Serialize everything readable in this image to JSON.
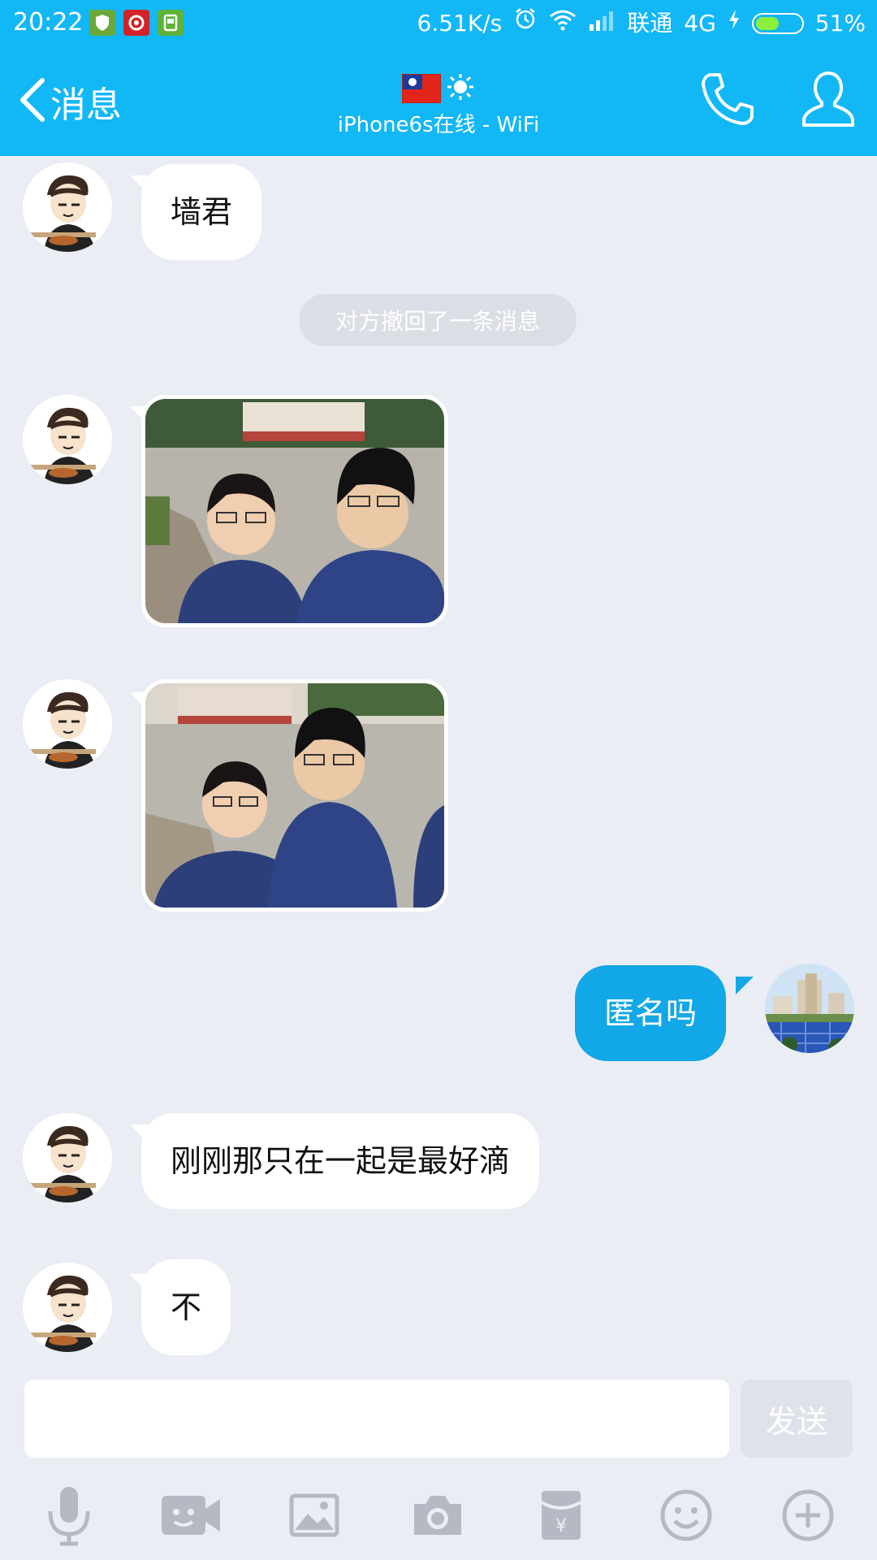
{
  "status_bar": {
    "time": "20:22",
    "network_speed": "6.51K/s",
    "carrier": "联通",
    "network_type": "4G",
    "battery_percent": "51%",
    "battery_level": 0.51
  },
  "header": {
    "back_label": "消息",
    "subtitle": "iPhone6s在线 - WiFi"
  },
  "messages": [
    {
      "sender": "contact",
      "type": "text",
      "text": "墙君"
    },
    {
      "type": "system",
      "text": "对方撤回了一条消息"
    },
    {
      "sender": "contact",
      "type": "image"
    },
    {
      "sender": "contact",
      "type": "image"
    },
    {
      "sender": "me",
      "type": "text",
      "text": "匿名吗"
    },
    {
      "sender": "contact",
      "type": "text",
      "text": "刚刚那只在一起是最好滴"
    },
    {
      "sender": "contact",
      "type": "text",
      "text": "不"
    }
  ],
  "composer": {
    "input_value": "",
    "send_label": "发送"
  },
  "toolbar": [
    "microphone-icon",
    "video-icon",
    "image-icon",
    "camera-icon",
    "red-packet-icon",
    "emoji-icon",
    "plus-icon"
  ],
  "colors": {
    "accent": "#12b7f5",
    "my_bubble": "#12a7e6",
    "background": "#ebedf5"
  }
}
